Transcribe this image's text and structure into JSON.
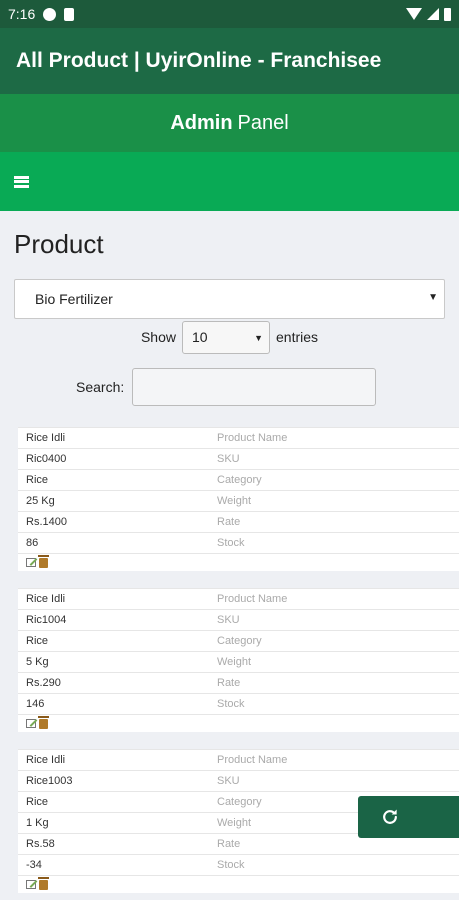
{
  "status_bar": {
    "time": "7:16"
  },
  "app_bar": {
    "title": "All Product | UyirOnline - Franchisee"
  },
  "admin_bar": {
    "bold": "Admin",
    "light": "Panel"
  },
  "page": {
    "title": "Product"
  },
  "category_select": {
    "value": "Bio Fertilizer"
  },
  "entries": {
    "show_label": "Show",
    "value": "10",
    "suffix_label": "entries"
  },
  "search": {
    "label": "Search:",
    "value": ""
  },
  "field_labels": [
    "Product Name",
    "SKU",
    "Category",
    "Weight",
    "Rate",
    "Stock"
  ],
  "products": [
    {
      "name": "Rice Idli",
      "sku": "Ric0400",
      "category": "Rice",
      "weight": "25 Kg",
      "rate": "Rs.1400",
      "stock": "86"
    },
    {
      "name": "Rice Idli",
      "sku": "Ric1004",
      "category": "Rice",
      "weight": "5 Kg",
      "rate": "Rs.290",
      "stock": "146"
    },
    {
      "name": "Rice Idli",
      "sku": "Rice1003",
      "category": "Rice",
      "weight": "1 Kg",
      "rate": "Rs.58",
      "stock": "-34"
    }
  ],
  "icons": {
    "menu": "hamburger-icon",
    "edit": "edit-icon",
    "delete": "trash-icon",
    "refresh": "refresh-icon"
  },
  "colors": {
    "status_bar": "#1d5a3b",
    "app_bar": "#1d6a45",
    "admin_bar": "#1a9048",
    "menu_bar": "#09aa55",
    "fab": "#1a6446"
  }
}
